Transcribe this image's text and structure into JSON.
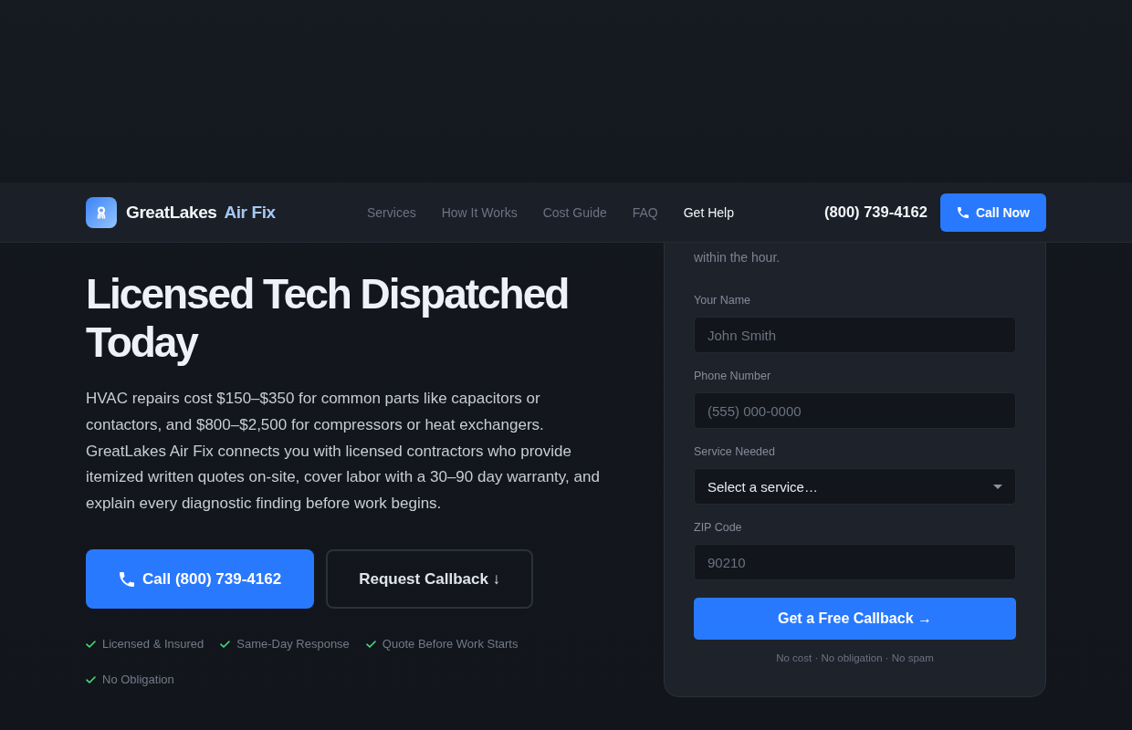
{
  "header": {
    "brand": {
      "name": "GreatLakes",
      "accent": "Air Fix"
    },
    "nav": [
      {
        "label": "Services",
        "selected": false
      },
      {
        "label": "How It Works",
        "selected": false
      },
      {
        "label": "Cost Guide",
        "selected": false
      },
      {
        "label": "FAQ",
        "selected": false
      },
      {
        "label": "Get Help",
        "selected": true
      }
    ],
    "phone": "(800) 739-4162",
    "call_button": "Call Now"
  },
  "hero": {
    "headline": "Licensed Tech Dispatched Today",
    "description": "HVAC repairs cost $150–$350 for common parts like capacitors or contactors, and $800–$2,500 for compressors or heat exchangers. GreatLakes Air Fix connects you with licensed contractors who provide itemized written quotes on-site, cover labor with a 30–90 day warranty, and explain every diagnostic finding before work begins.",
    "buttons": [
      {
        "kind": "primary",
        "label": "Call (800) 739-4162"
      },
      {
        "kind": "secondary",
        "label": "Request Callback ↓"
      }
    ],
    "badges": [
      "Licensed & Insured",
      "Same-Day Response",
      "Quote Before Work Starts",
      "No Obligation"
    ]
  },
  "form": {
    "subtitle": "within the hour.",
    "fields": [
      {
        "kind": "text",
        "label": "Your Name",
        "placeholder": "John Smith"
      },
      {
        "kind": "text",
        "label": "Phone Number",
        "placeholder": "(555) 000-0000"
      },
      {
        "kind": "select",
        "label": "Service Needed",
        "value": "Select a service…"
      },
      {
        "kind": "text",
        "label": "ZIP Code",
        "placeholder": "90210"
      }
    ],
    "submit": "Get a Free Callback →",
    "note": "No cost · No obligation · No spam"
  }
}
